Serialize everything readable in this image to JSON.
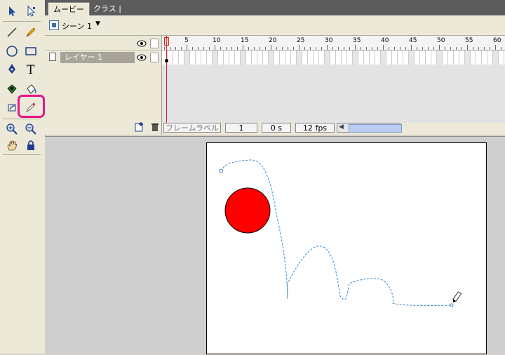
{
  "tabs": [
    {
      "label": "ムービー",
      "active": true
    },
    {
      "label": "クラス",
      "active": false
    }
  ],
  "scene": {
    "label": "シーン 1",
    "caret": "▼"
  },
  "layer": {
    "name": "レイヤー 1"
  },
  "ruler_labels": [
    "5",
    "10",
    "15",
    "20",
    "25",
    "30",
    "35",
    "40",
    "45",
    "50",
    "55",
    "60"
  ],
  "status": {
    "frame_label": "フレームラベル",
    "frame_number": "1",
    "elapsed": "0 s",
    "fps": "12 fps"
  },
  "tools": [
    "arrow-icon",
    "subselect-icon",
    "line-icon",
    "pencil-icon",
    "oval-icon",
    "rectangle-icon",
    "pen-icon",
    "text-icon",
    "ink-bottle-icon",
    "paint-bucket-icon",
    "transform-icon",
    "eraser-pencil-icon",
    "zoom-in-icon",
    "zoom-out-icon",
    "hand-icon",
    "lock-icon"
  ],
  "colors": {
    "highlight": "#e6168a",
    "circle_fill": "#ff0000",
    "path_stroke": "#3a86c8"
  }
}
